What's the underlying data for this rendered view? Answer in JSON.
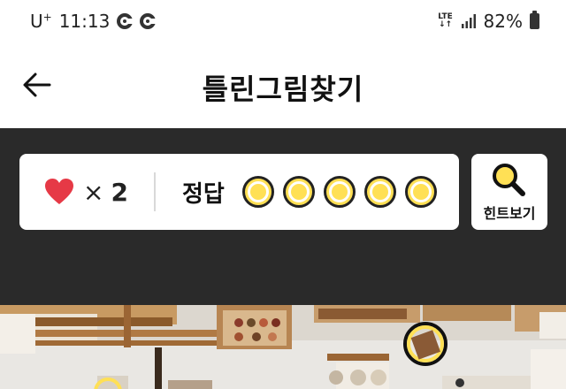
{
  "status_bar": {
    "carrier": "U",
    "carrier_sup": "+",
    "time": "11:13",
    "network_top": "LTE",
    "network_bottom": "↓↑",
    "battery": "82%",
    "icons": [
      "app-notification-icon",
      "app-notification-icon",
      "signal-icon",
      "battery-icon"
    ]
  },
  "header": {
    "title": "틀린그림찾기",
    "back_icon": "back-arrow-icon"
  },
  "game": {
    "lives_symbol": "×",
    "lives": "2",
    "answers_label": "정답",
    "answers_total": 5,
    "answers_found": 0,
    "hint_label": "힌트보기",
    "hint_icon": "magnifier-icon",
    "accent_color": "#ffe055",
    "heart_color": "#e63946"
  }
}
